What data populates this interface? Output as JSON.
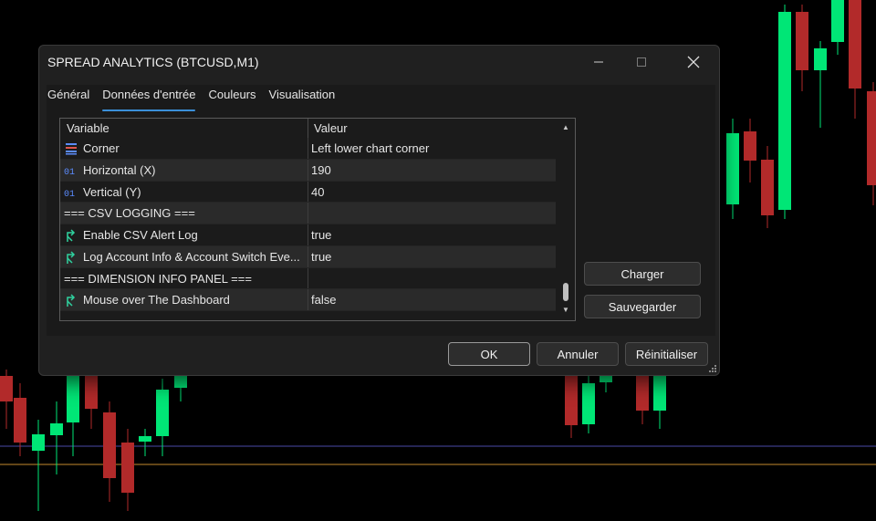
{
  "dialog": {
    "title": "SPREAD ANALYTICS (BTCUSD,M1)",
    "window_controls": {
      "minimize_icon": "minimize-icon",
      "maximize_icon": "maximize-icon",
      "close_icon": "close-icon"
    },
    "tabs": [
      {
        "label": "Général",
        "active": false
      },
      {
        "label": "Données d'entrée",
        "active": true
      },
      {
        "label": "Couleurs",
        "active": false
      },
      {
        "label": "Visualisation",
        "active": false
      }
    ],
    "table": {
      "columns": [
        "Variable",
        "Valeur"
      ],
      "rows": [
        {
          "icon": "enum-icon",
          "name": "Corner",
          "value": "Left lower chart corner",
          "section": false
        },
        {
          "icon": "integer-icon",
          "name": "Horizontal (X)",
          "value": "190",
          "section": false
        },
        {
          "icon": "integer-icon",
          "name": "Vertical (Y)",
          "value": "40",
          "section": false
        },
        {
          "icon": "",
          "name": "=== CSV LOGGING ===",
          "value": "",
          "section": true
        },
        {
          "icon": "bool-icon",
          "name": "Enable CSV Alert Log",
          "value": "true",
          "section": false
        },
        {
          "icon": "bool-icon",
          "name": "Log Account Info & Account Switch Eve...",
          "value": "true",
          "section": false
        },
        {
          "icon": "",
          "name": "=== DIMENSION INFO PANEL ===",
          "value": "",
          "section": true
        },
        {
          "icon": "bool-icon",
          "name": "Mouse over The Dashboard",
          "value": "false",
          "section": false
        }
      ]
    },
    "side_buttons": {
      "load": "Charger",
      "save": "Sauvegarder"
    },
    "footer_buttons": {
      "ok": "OK",
      "cancel": "Annuler",
      "reset": "Réinitialiser"
    }
  },
  "colors": {
    "bull": "#00e676",
    "bear": "#b22a2a",
    "accent": "#3b8fd9"
  }
}
